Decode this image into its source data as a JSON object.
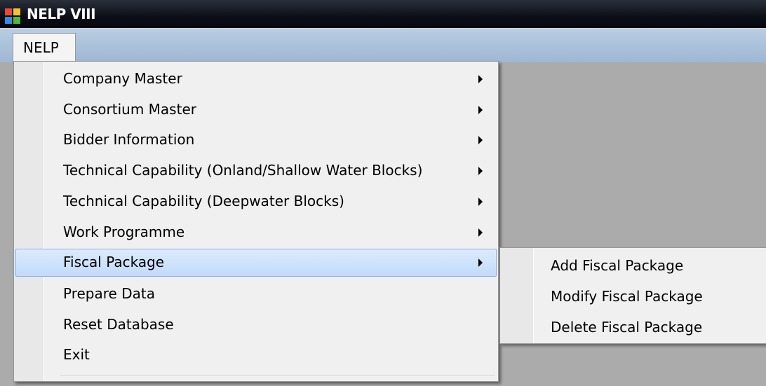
{
  "window": {
    "title": "NELP VIII",
    "icon": "app-window-icon"
  },
  "menubar": {
    "items": [
      {
        "label": "NELP"
      }
    ]
  },
  "menu": {
    "items": [
      {
        "label": "Company Master",
        "submenu": true
      },
      {
        "label": "Consortium Master",
        "submenu": true
      },
      {
        "label": "Bidder Information",
        "submenu": true
      },
      {
        "label": "Technical Capability (Onland/Shallow Water Blocks)",
        "submenu": true
      },
      {
        "label": "Technical Capability (Deepwater Blocks)",
        "submenu": true
      },
      {
        "label": "Work Programme",
        "submenu": true
      },
      {
        "label": "Fiscal Package",
        "submenu": true,
        "highlighted": true
      },
      {
        "label": "Prepare Data",
        "submenu": false
      },
      {
        "label": "Reset Database",
        "submenu": false
      },
      {
        "label": "Exit",
        "submenu": false
      }
    ]
  },
  "submenu": {
    "items": [
      {
        "label": "Add Fiscal Package"
      },
      {
        "label": "Modify Fiscal Package"
      },
      {
        "label": "Delete Fiscal Package"
      }
    ]
  },
  "colors": {
    "highlight": "#c1dbfb",
    "highlight_border": "#86b0e6",
    "menubar": "#9eb7d3",
    "workspace": "#ababab"
  }
}
